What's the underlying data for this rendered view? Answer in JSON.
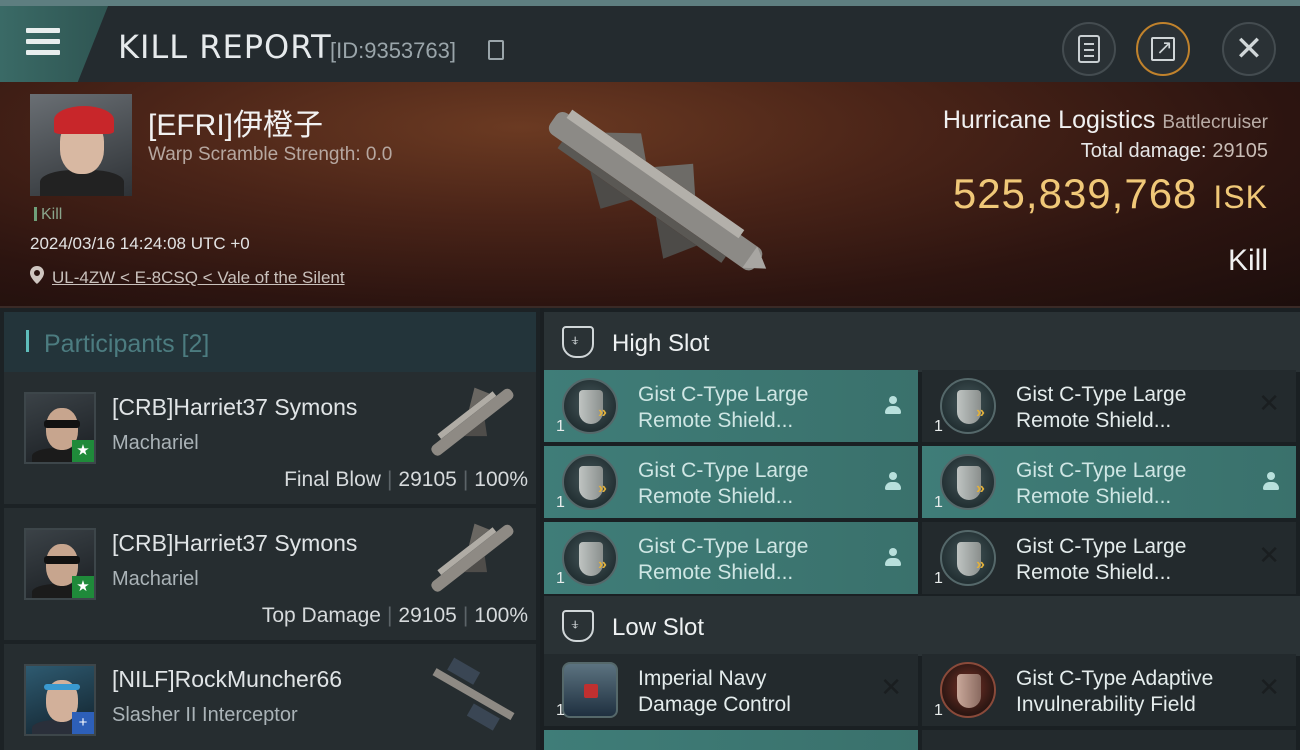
{
  "header": {
    "title": "KILL REPORT",
    "id_text": "[ID:9353763]"
  },
  "victim": {
    "name": "[EFRI]伊橙子",
    "warp_scramble": "Warp Scramble Strength: 0.0",
    "tag": "Kill",
    "datetime": "2024/03/16 14:24:08 UTC +0",
    "location": "UL-4ZW < E-8CSQ < Vale of the Silent",
    "ship_name": "Hurricane Logistics",
    "ship_class": "Battlecruiser",
    "total_damage_label": "Total damage:",
    "total_damage": "29105",
    "isk_value": "525,839,768",
    "isk_unit": "ISK",
    "result": "Kill"
  },
  "participants": {
    "title": "Participants [2]",
    "rows": [
      {
        "name": "[CRB]Harriet37 Symons",
        "ship": "Machariel",
        "role": "Final Blow",
        "damage": "29105",
        "percent": "100%",
        "badge": "★"
      },
      {
        "name": "[CRB]Harriet37 Symons",
        "ship": "Machariel",
        "role": "Top Damage",
        "damage": "29105",
        "percent": "100%",
        "badge": "★"
      },
      {
        "name": "[NILF]RockMuncher66",
        "ship": "Slasher II Interceptor",
        "badge": "+"
      }
    ]
  },
  "fitting": {
    "high_slot_label": "High Slot",
    "low_slot_label": "Low Slot",
    "high_slots": [
      {
        "qty": "1",
        "line1": "Gist C-Type Large",
        "line2": "Remote Shield...",
        "state": "active",
        "status": "person"
      },
      {
        "qty": "1",
        "line1": "Gist C-Type Large",
        "line2": "Remote Shield...",
        "state": "inactive",
        "status": "x"
      },
      {
        "qty": "1",
        "line1": "Gist C-Type Large",
        "line2": "Remote Shield...",
        "state": "active",
        "status": "person"
      },
      {
        "qty": "1",
        "line1": "Gist C-Type Large",
        "line2": "Remote Shield...",
        "state": "active",
        "status": "person"
      },
      {
        "qty": "1",
        "line1": "Gist C-Type Large",
        "line2": "Remote Shield...",
        "state": "active",
        "status": "person"
      },
      {
        "qty": "1",
        "line1": "Gist C-Type Large",
        "line2": "Remote Shield...",
        "state": "inactive",
        "status": "x"
      }
    ],
    "low_slots": [
      {
        "qty": "1",
        "line1": "Imperial Navy",
        "line2": "Damage Control",
        "state": "inactive",
        "status": "x"
      },
      {
        "qty": "1",
        "line1": "Gist C-Type Adaptive",
        "line2": "Invulnerability Field",
        "state": "inactive",
        "status": "x"
      }
    ]
  },
  "colors": {
    "accent_teal": "#3f7d78",
    "isk_gold": "#f0c878",
    "hero_red": "#4a2418"
  }
}
